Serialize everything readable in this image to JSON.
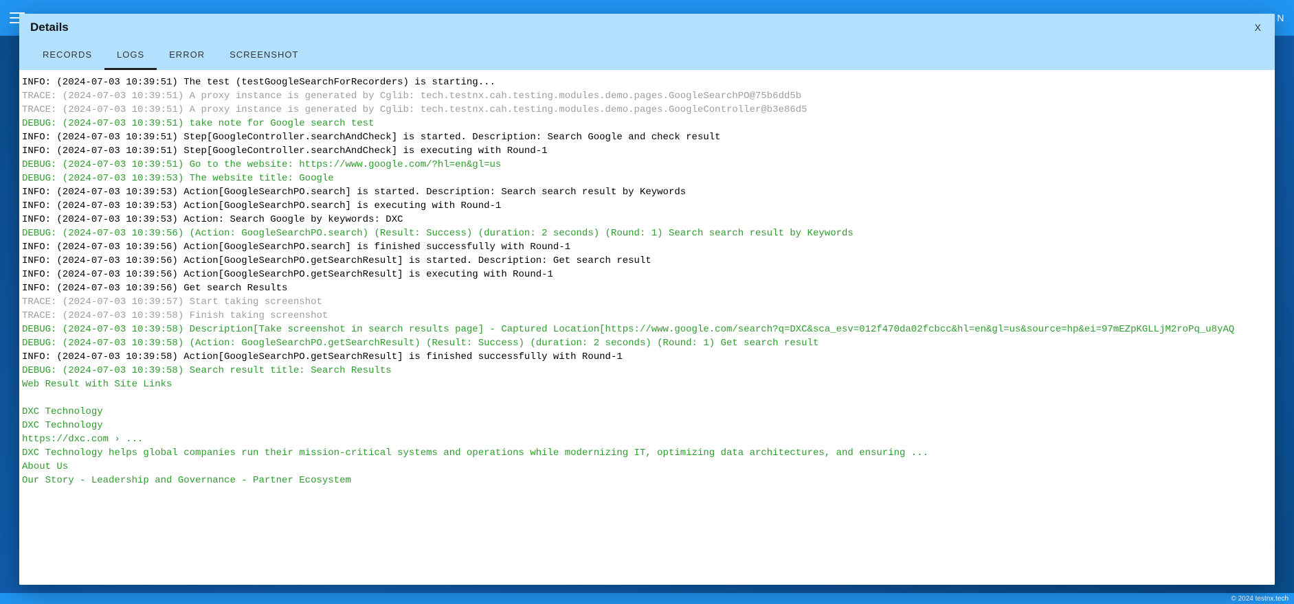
{
  "topbar": {
    "right_letter": "N"
  },
  "footer": {
    "text": "© 2024 testnx.tech"
  },
  "modal": {
    "title": "Details",
    "close_label": "X",
    "tabs": [
      {
        "label": "RECORDS",
        "active": false
      },
      {
        "label": "LOGS",
        "active": true
      },
      {
        "label": "ERROR",
        "active": false
      },
      {
        "label": "SCREENSHOT",
        "active": false
      }
    ],
    "logs": [
      {
        "level": "INFO",
        "text": "INFO: (2024-07-03 10:39:51) The test (testGoogleSearchForRecorders) is starting..."
      },
      {
        "level": "TRACE",
        "text": "TRACE: (2024-07-03 10:39:51) A proxy instance is generated by Cglib: tech.testnx.cah.testing.modules.demo.pages.GoogleSearchPO@75b6dd5b"
      },
      {
        "level": "TRACE",
        "text": "TRACE: (2024-07-03 10:39:51) A proxy instance is generated by Cglib: tech.testnx.cah.testing.modules.demo.pages.GoogleController@b3e86d5"
      },
      {
        "level": "DEBUG",
        "text": "DEBUG: (2024-07-03 10:39:51) take note for Google search test"
      },
      {
        "level": "INFO",
        "text": "INFO: (2024-07-03 10:39:51) Step[GoogleController.searchAndCheck] is started. Description: Search Google and check result"
      },
      {
        "level": "INFO",
        "text": "INFO: (2024-07-03 10:39:51) Step[GoogleController.searchAndCheck] is executing with Round-1"
      },
      {
        "level": "DEBUG",
        "text": "DEBUG: (2024-07-03 10:39:51) Go to the website: https://www.google.com/?hl=en&gl=us"
      },
      {
        "level": "DEBUG",
        "text": "DEBUG: (2024-07-03 10:39:53) The website title: Google"
      },
      {
        "level": "INFO",
        "text": "INFO: (2024-07-03 10:39:53) Action[GoogleSearchPO.search] is started. Description: Search search result by Keywords"
      },
      {
        "level": "INFO",
        "text": "INFO: (2024-07-03 10:39:53) Action[GoogleSearchPO.search] is executing with Round-1"
      },
      {
        "level": "INFO",
        "text": "INFO: (2024-07-03 10:39:53) Action: Search Google by keywords: DXC"
      },
      {
        "level": "DEBUG",
        "text": "DEBUG: (2024-07-03 10:39:56) (Action: GoogleSearchPO.search) (Result: Success) (duration: 2 seconds) (Round: 1) Search search result by Keywords"
      },
      {
        "level": "INFO",
        "text": "INFO: (2024-07-03 10:39:56) Action[GoogleSearchPO.search] is finished successfully with Round-1"
      },
      {
        "level": "INFO",
        "text": "INFO: (2024-07-03 10:39:56) Action[GoogleSearchPO.getSearchResult] is started. Description: Get search result"
      },
      {
        "level": "INFO",
        "text": "INFO: (2024-07-03 10:39:56) Action[GoogleSearchPO.getSearchResult] is executing with Round-1"
      },
      {
        "level": "INFO",
        "text": "INFO: (2024-07-03 10:39:56) Get search Results"
      },
      {
        "level": "TRACE",
        "text": "TRACE: (2024-07-03 10:39:57) Start taking screenshot"
      },
      {
        "level": "TRACE",
        "text": "TRACE: (2024-07-03 10:39:58) Finish taking screenshot"
      },
      {
        "level": "DEBUG",
        "text": "DEBUG: (2024-07-03 10:39:58) Description[Take screenshot in search results page] - Captured Location[https://www.google.com/search?q=DXC&sca_esv=012f470da02fcbcc&hl=en&gl=us&source=hp&ei=97mEZpKGLLjM2roPq_u8yAQ"
      },
      {
        "level": "DEBUG",
        "text": "DEBUG: (2024-07-03 10:39:58) (Action: GoogleSearchPO.getSearchResult) (Result: Success) (duration: 2 seconds) (Round: 1) Get search result"
      },
      {
        "level": "INFO",
        "text": "INFO: (2024-07-03 10:39:58) Action[GoogleSearchPO.getSearchResult] is finished successfully with Round-1"
      },
      {
        "level": "DEBUG",
        "text": "DEBUG: (2024-07-03 10:39:58) Search result title: Search Results"
      },
      {
        "level": "DEBUG",
        "text": "Web Result with Site Links"
      },
      {
        "level": "DEBUG",
        "text": ""
      },
      {
        "level": "DEBUG",
        "text": "DXC Technology"
      },
      {
        "level": "DEBUG",
        "text": "DXC Technology"
      },
      {
        "level": "DEBUG",
        "text": "https://dxc.com › ..."
      },
      {
        "level": "DEBUG",
        "text": "DXC Technology helps global companies run their mission-critical systems and operations while modernizing IT, optimizing data architectures, and ensuring ..."
      },
      {
        "level": "DEBUG",
        "text": "About Us"
      },
      {
        "level": "DEBUG",
        "text": "Our Story - Leadership and Governance - Partner Ecosystem"
      }
    ]
  }
}
